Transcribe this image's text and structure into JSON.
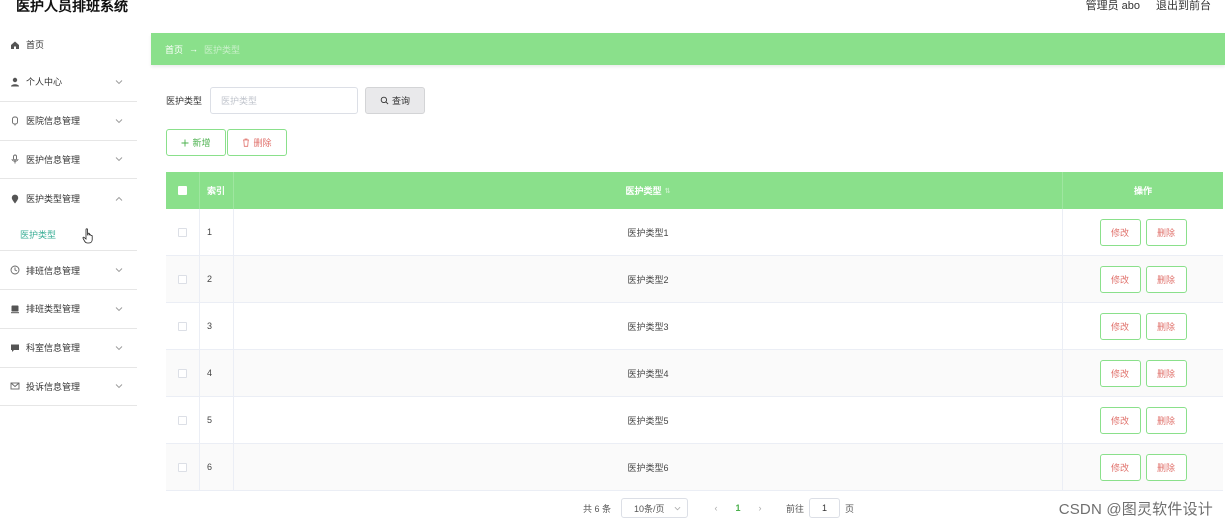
{
  "app": {
    "title": "医护人员排班系统",
    "user_label": "管理员 abo",
    "exit_label": "退出到前台"
  },
  "sidebar": {
    "items": [
      {
        "label": "首页",
        "icon": "home-icon"
      },
      {
        "label": "个人中心",
        "icon": "user-icon"
      },
      {
        "label": "医院信息管理",
        "icon": "hospital-icon"
      },
      {
        "label": "医护信息管理",
        "icon": "microphone-icon"
      },
      {
        "label": "医护类型管理",
        "icon": "location-icon"
      },
      {
        "label": "排班信息管理",
        "icon": "clock-icon"
      },
      {
        "label": "排班类型管理",
        "icon": "document-icon"
      },
      {
        "label": "科室信息管理",
        "icon": "chat-icon"
      },
      {
        "label": "投诉信息管理",
        "icon": "mail-icon"
      }
    ],
    "sub_item": "医护类型"
  },
  "breadcrumb": {
    "home": "首页",
    "separator": "→",
    "current": "医护类型"
  },
  "search": {
    "label": "医护类型",
    "placeholder": "医护类型",
    "button": "查询"
  },
  "actions": {
    "add": "新增",
    "delete": "删除"
  },
  "table": {
    "headers": {
      "index": "索引",
      "type": "医护类型",
      "ops": "操作"
    },
    "rows": [
      {
        "index": "1",
        "type": "医护类型1"
      },
      {
        "index": "2",
        "type": "医护类型2"
      },
      {
        "index": "3",
        "type": "医护类型3"
      },
      {
        "index": "4",
        "type": "医护类型4"
      },
      {
        "index": "5",
        "type": "医护类型5"
      },
      {
        "index": "6",
        "type": "医护类型6"
      }
    ],
    "edit_label": "修改",
    "delete_label": "删除"
  },
  "pagination": {
    "total": "共 6 条",
    "page_size": "10条/页",
    "current_page": "1",
    "goto_label": "前往",
    "goto_value": "1",
    "page_suffix": "页"
  },
  "watermark": "CSDN @图灵软件设计",
  "colors": {
    "accent_green": "#8ae08b",
    "active_teal": "#3aae96",
    "danger_text": "#e0716b"
  }
}
